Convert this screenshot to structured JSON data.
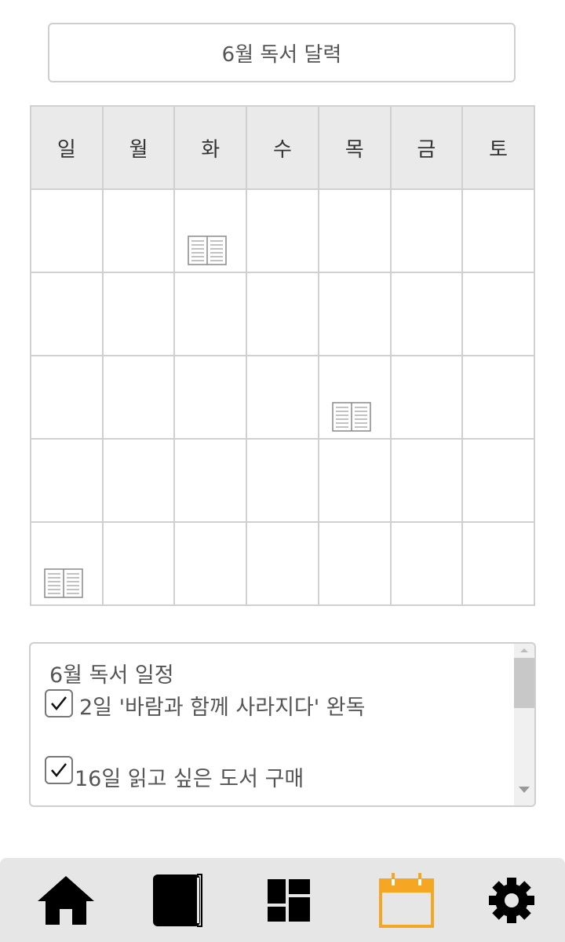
{
  "header": {
    "title": "6월 독서 달력"
  },
  "calendar": {
    "weekdays": [
      "일",
      "월",
      "화",
      "수",
      "목",
      "금",
      "토"
    ],
    "rows": 5,
    "book_marks": [
      {
        "row": 0,
        "col": 2
      },
      {
        "row": 2,
        "col": 4
      },
      {
        "row": 4,
        "col": 0
      }
    ]
  },
  "schedule": {
    "title": "6월 독서 일정",
    "items": [
      {
        "label": "2일 '바람과 함께 사라지다' 완독",
        "checked": true
      },
      {
        "label": "16일 읽고 싶은 도서 구매",
        "checked": true
      }
    ]
  },
  "bottom_nav": {
    "items": [
      {
        "icon": "home-icon",
        "active": false
      },
      {
        "icon": "book-icon",
        "active": false
      },
      {
        "icon": "dashboard-icon",
        "active": false
      },
      {
        "icon": "calendar-icon",
        "active": true
      },
      {
        "icon": "settings-icon",
        "active": false
      }
    ],
    "active_color": "#f5a623",
    "icon_color": "#000000"
  }
}
